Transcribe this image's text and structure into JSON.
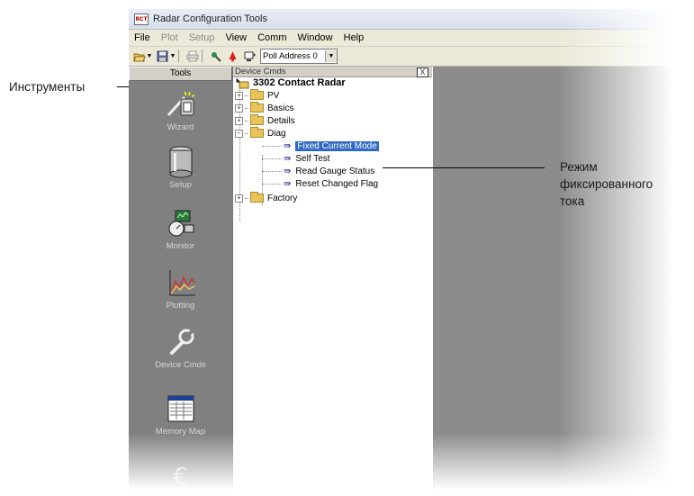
{
  "window": {
    "title": "Radar Configuration Tools",
    "app_icon_text": "RCT"
  },
  "menu": [
    {
      "label": "File",
      "enabled": true
    },
    {
      "label": "Plot",
      "enabled": false
    },
    {
      "label": "Setup",
      "enabled": false
    },
    {
      "label": "View",
      "enabled": true
    },
    {
      "label": "Comm",
      "enabled": true
    },
    {
      "label": "Window",
      "enabled": true
    },
    {
      "label": "Help",
      "enabled": true
    }
  ],
  "toolbar": {
    "poll_address": "Poll Address 0",
    "icons": [
      "open-icon",
      "save-icon",
      "print-icon",
      "hart-icon",
      "alarm-icon",
      "poll-icon"
    ]
  },
  "tools_panel": {
    "header": "Tools",
    "items": [
      {
        "label": "Wizard",
        "icon": "wizard-icon"
      },
      {
        "label": "Setup",
        "icon": "setup-icon"
      },
      {
        "label": "Monitor",
        "icon": "monitor-icon"
      },
      {
        "label": "Plotting",
        "icon": "plotting-icon"
      },
      {
        "label": "Device Cmds",
        "icon": "device-cmds-icon"
      },
      {
        "label": "Memory Map",
        "icon": "memory-map-icon"
      }
    ]
  },
  "device_cmds": {
    "header": "Device Cmds",
    "close_label": "X",
    "root": "3302 Contact Radar",
    "folders": {
      "pv": "PV",
      "basics": "Basics",
      "details": "Details",
      "diag": "Diag",
      "factory": "Factory"
    },
    "diag_commands": [
      "Fixed Current Mode",
      "Self Test",
      "Read Gauge Status",
      "Reset Changed Flag"
    ],
    "selected": "Fixed Current Mode"
  },
  "callouts": {
    "tools": "Инструменты",
    "fixed_current": [
      "Режим",
      "фиксированного",
      "тока"
    ]
  },
  "colors": {
    "selection": "#316ac5",
    "tools_bg": "#808080",
    "workspace_bg": "#8c8c8c"
  }
}
